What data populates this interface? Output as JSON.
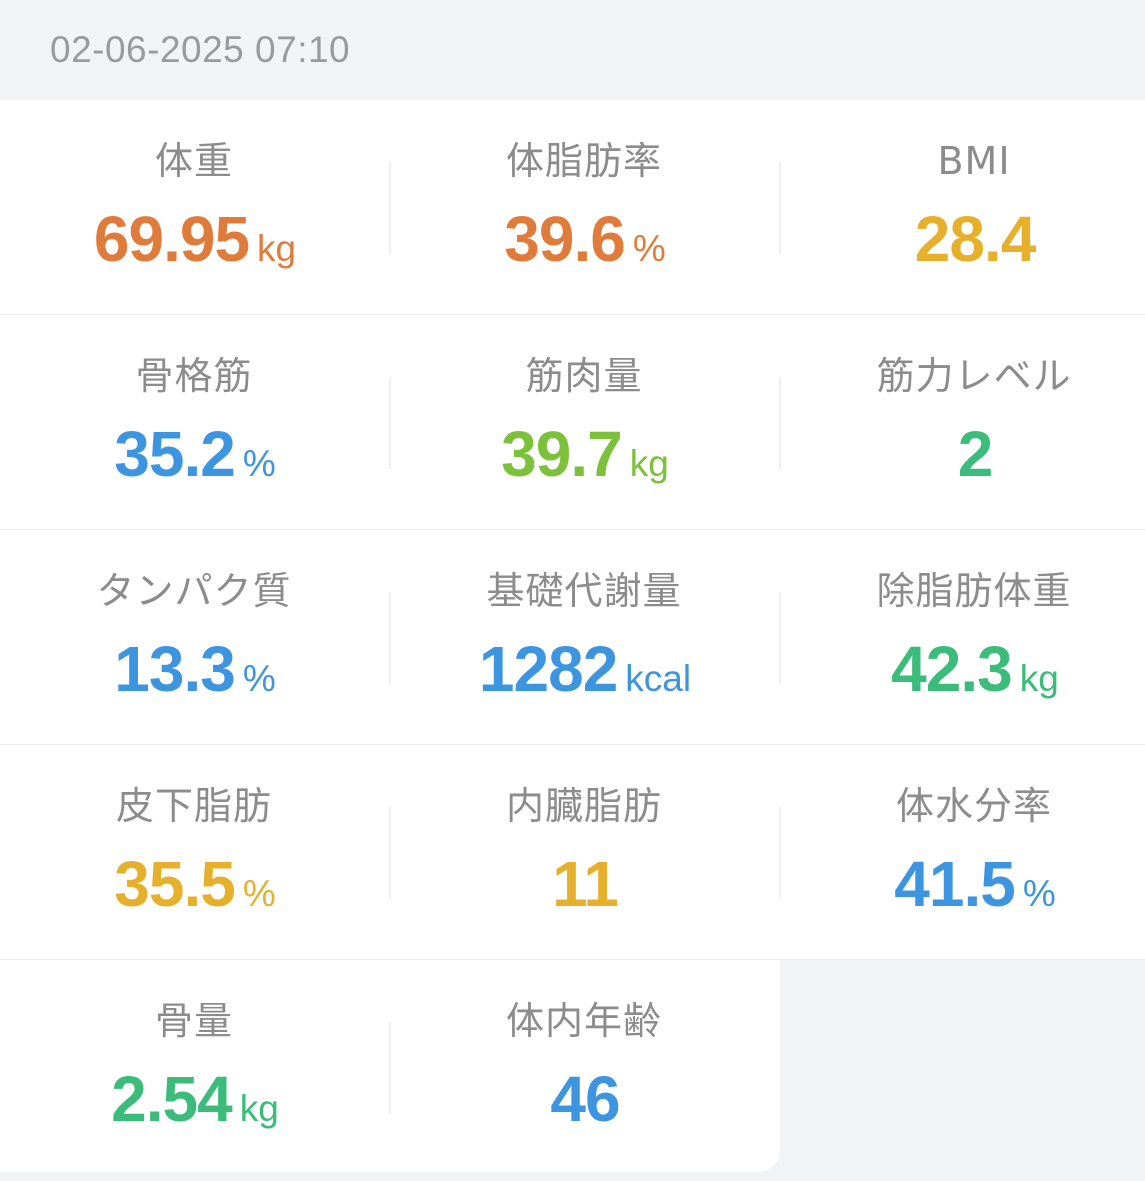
{
  "header": {
    "timestamp": "02-06-2025 07:10"
  },
  "colors": {
    "orange": "#e07c3b",
    "gold": "#e6b02c",
    "blue": "#3d95e0",
    "lime": "#7bc13a",
    "green": "#3cbc7a"
  },
  "metrics": [
    {
      "label": "体重",
      "value": "69.95",
      "unit": "kg",
      "color": "orange"
    },
    {
      "label": "体脂肪率",
      "value": "39.6",
      "unit": "%",
      "color": "orange"
    },
    {
      "label": "BMI",
      "value": "28.4",
      "unit": "",
      "color": "gold"
    },
    {
      "label": "骨格筋",
      "value": "35.2",
      "unit": "%",
      "color": "blue"
    },
    {
      "label": "筋肉量",
      "value": "39.7",
      "unit": "kg",
      "color": "lime"
    },
    {
      "label": "筋力レベル",
      "value": "2",
      "unit": "",
      "color": "green"
    },
    {
      "label": "タンパク質",
      "value": "13.3",
      "unit": "%",
      "color": "blue"
    },
    {
      "label": "基礎代謝量",
      "value": "1282",
      "unit": "kcal",
      "color": "blue"
    },
    {
      "label": "除脂肪体重",
      "value": "42.3",
      "unit": "kg",
      "color": "green"
    },
    {
      "label": "皮下脂肪",
      "value": "35.5",
      "unit": "%",
      "color": "gold"
    },
    {
      "label": "内臓脂肪",
      "value": "11",
      "unit": "",
      "color": "gold"
    },
    {
      "label": "体水分率",
      "value": "41.5",
      "unit": "%",
      "color": "blue"
    },
    {
      "label": "骨量",
      "value": "2.54",
      "unit": "kg",
      "color": "green"
    },
    {
      "label": "体内年齢",
      "value": "46",
      "unit": "",
      "color": "blue"
    }
  ]
}
